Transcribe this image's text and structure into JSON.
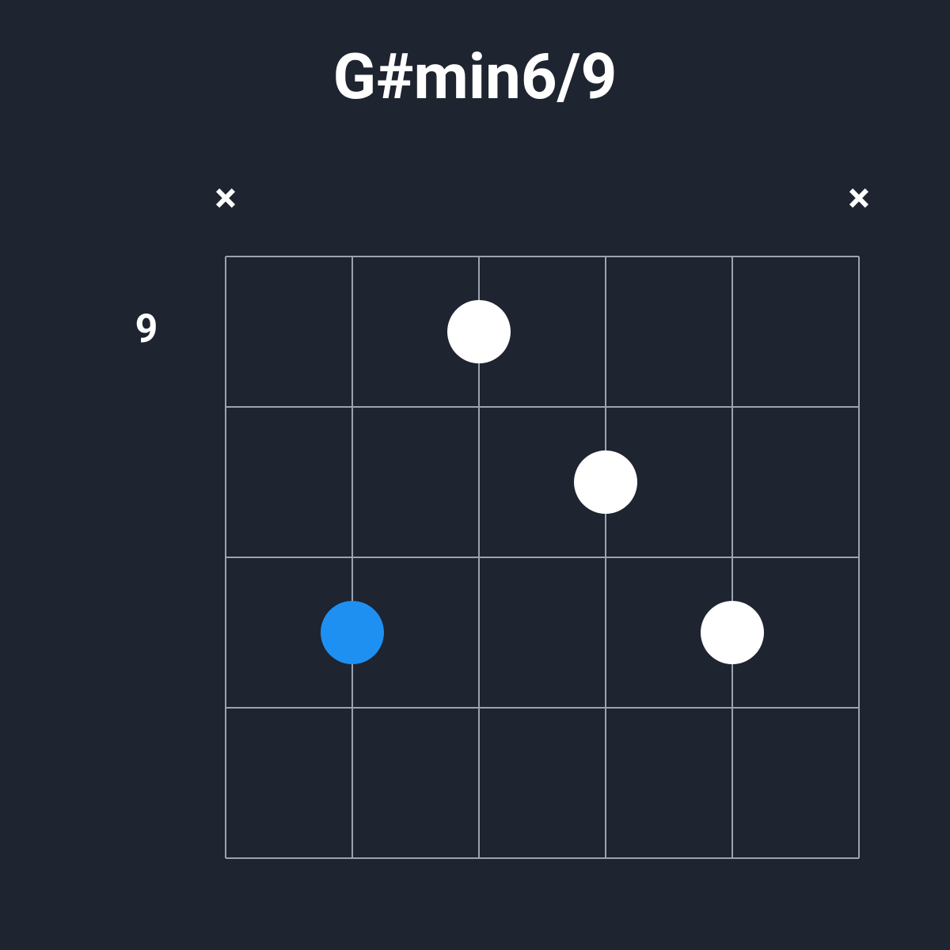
{
  "chord": {
    "name": "G#min6/9",
    "starting_fret": 9,
    "num_frets": 4,
    "num_strings": 6,
    "string_markers": [
      "x",
      null,
      null,
      null,
      null,
      "x"
    ],
    "positions": [
      {
        "string": 2,
        "fret": 3,
        "type": "root"
      },
      {
        "string": 3,
        "fret": 1,
        "type": "normal"
      },
      {
        "string": 4,
        "fret": 2,
        "type": "normal"
      },
      {
        "string": 5,
        "fret": 3,
        "type": "normal"
      }
    ]
  },
  "chart_data": {
    "type": "chord-diagram",
    "title": "G#min6/9",
    "starting_fret_label": "9",
    "strings": [
      1,
      2,
      3,
      4,
      5,
      6
    ],
    "frets_shown": [
      9,
      10,
      11,
      12
    ],
    "muted_strings": [
      1,
      6
    ],
    "open_strings": [],
    "fingered": [
      {
        "string": 2,
        "absolute_fret": 11,
        "is_root": true
      },
      {
        "string": 3,
        "absolute_fret": 9,
        "is_root": false
      },
      {
        "string": 4,
        "absolute_fret": 10,
        "is_root": false
      },
      {
        "string": 5,
        "absolute_fret": 11,
        "is_root": false
      }
    ],
    "colors": {
      "background": "#1e2430",
      "grid": "#9aa3b0",
      "dot_normal": "#ffffff",
      "dot_root": "#1e90f2",
      "text": "#ffffff"
    }
  }
}
